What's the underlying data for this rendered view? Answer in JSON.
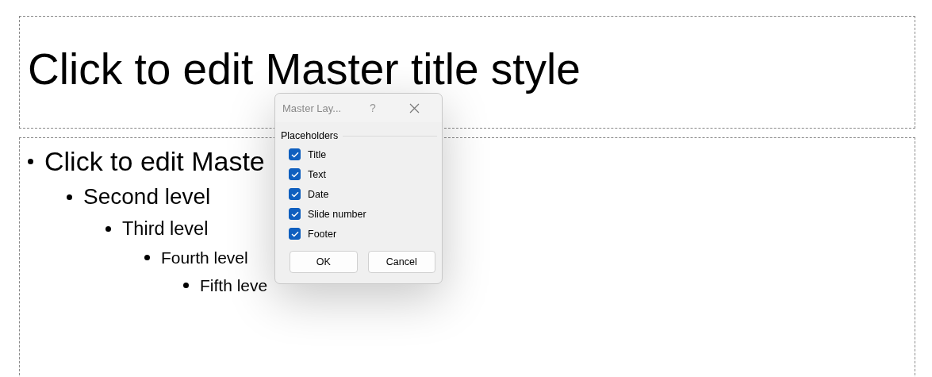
{
  "title_placeholder": {
    "text": "Click to edit Master title style"
  },
  "body_placeholder": {
    "items": [
      {
        "text": "Click to edit Maste",
        "children": [
          {
            "text": "Second level",
            "children": [
              {
                "text": "Third level",
                "children": [
                  {
                    "text": "Fourth level",
                    "children": [
                      {
                        "text": "Fifth leve"
                      }
                    ]
                  }
                ]
              }
            ]
          }
        ]
      }
    ]
  },
  "dialog": {
    "title": "Master Lay...",
    "help": "?",
    "group": "Placeholders",
    "options": [
      {
        "label": "Title",
        "checked": true
      },
      {
        "label": "Text",
        "checked": true
      },
      {
        "label": "Date",
        "checked": true
      },
      {
        "label": "Slide number",
        "checked": true
      },
      {
        "label": "Footer",
        "checked": true
      }
    ],
    "buttons": [
      "OK",
      "Cancel"
    ]
  }
}
